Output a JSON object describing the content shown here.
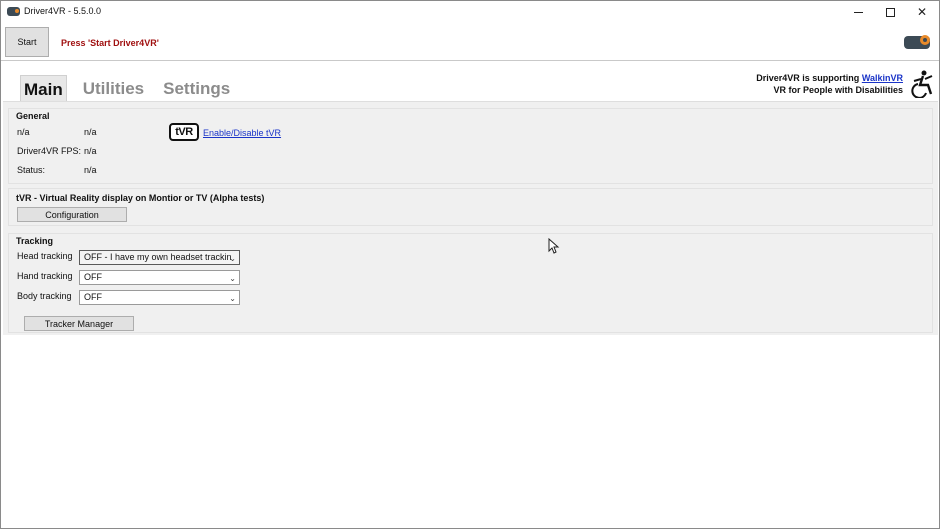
{
  "window": {
    "title": "Driver4VR - 5.5.0.0",
    "controls": {
      "minimize": "minimize-icon",
      "maximize": "maximize-icon",
      "close": "close-icon"
    }
  },
  "toolbar": {
    "start_label": "Start",
    "status_message": "Press 'Start Driver4VR'",
    "status_color": "#a01010"
  },
  "tabs": [
    {
      "label": "Main",
      "active": true
    },
    {
      "label": "Utilities",
      "active": false
    },
    {
      "label": "Settings",
      "active": false
    }
  ],
  "support": {
    "line1_prefix": "Driver4VR is supporting",
    "line1_link": "WalkinVR",
    "line2": "VR for People with Disabilities",
    "link_color": "#1a34c8"
  },
  "general": {
    "title": "General",
    "rows": [
      {
        "label": "n/a",
        "value": "n/a"
      },
      {
        "label": "Driver4VR FPS:",
        "value": "n/a"
      },
      {
        "label": "Status:",
        "value": "n/a"
      }
    ],
    "tvr_badge": "tVR",
    "tvr_link": "Enable/Disable tVR"
  },
  "tvr": {
    "title": "tVR - Virtual Reality display on Montior or TV (Alpha tests)",
    "config_label": "Configuration"
  },
  "tracking": {
    "title": "Tracking",
    "head_label": "Head tracking",
    "head_value": "OFF - I have my own headset trackin",
    "hand_label": "Hand tracking",
    "hand_value": "OFF",
    "body_label": "Body tracking",
    "body_value": "OFF",
    "tracker_manager_label": "Tracker Manager"
  }
}
